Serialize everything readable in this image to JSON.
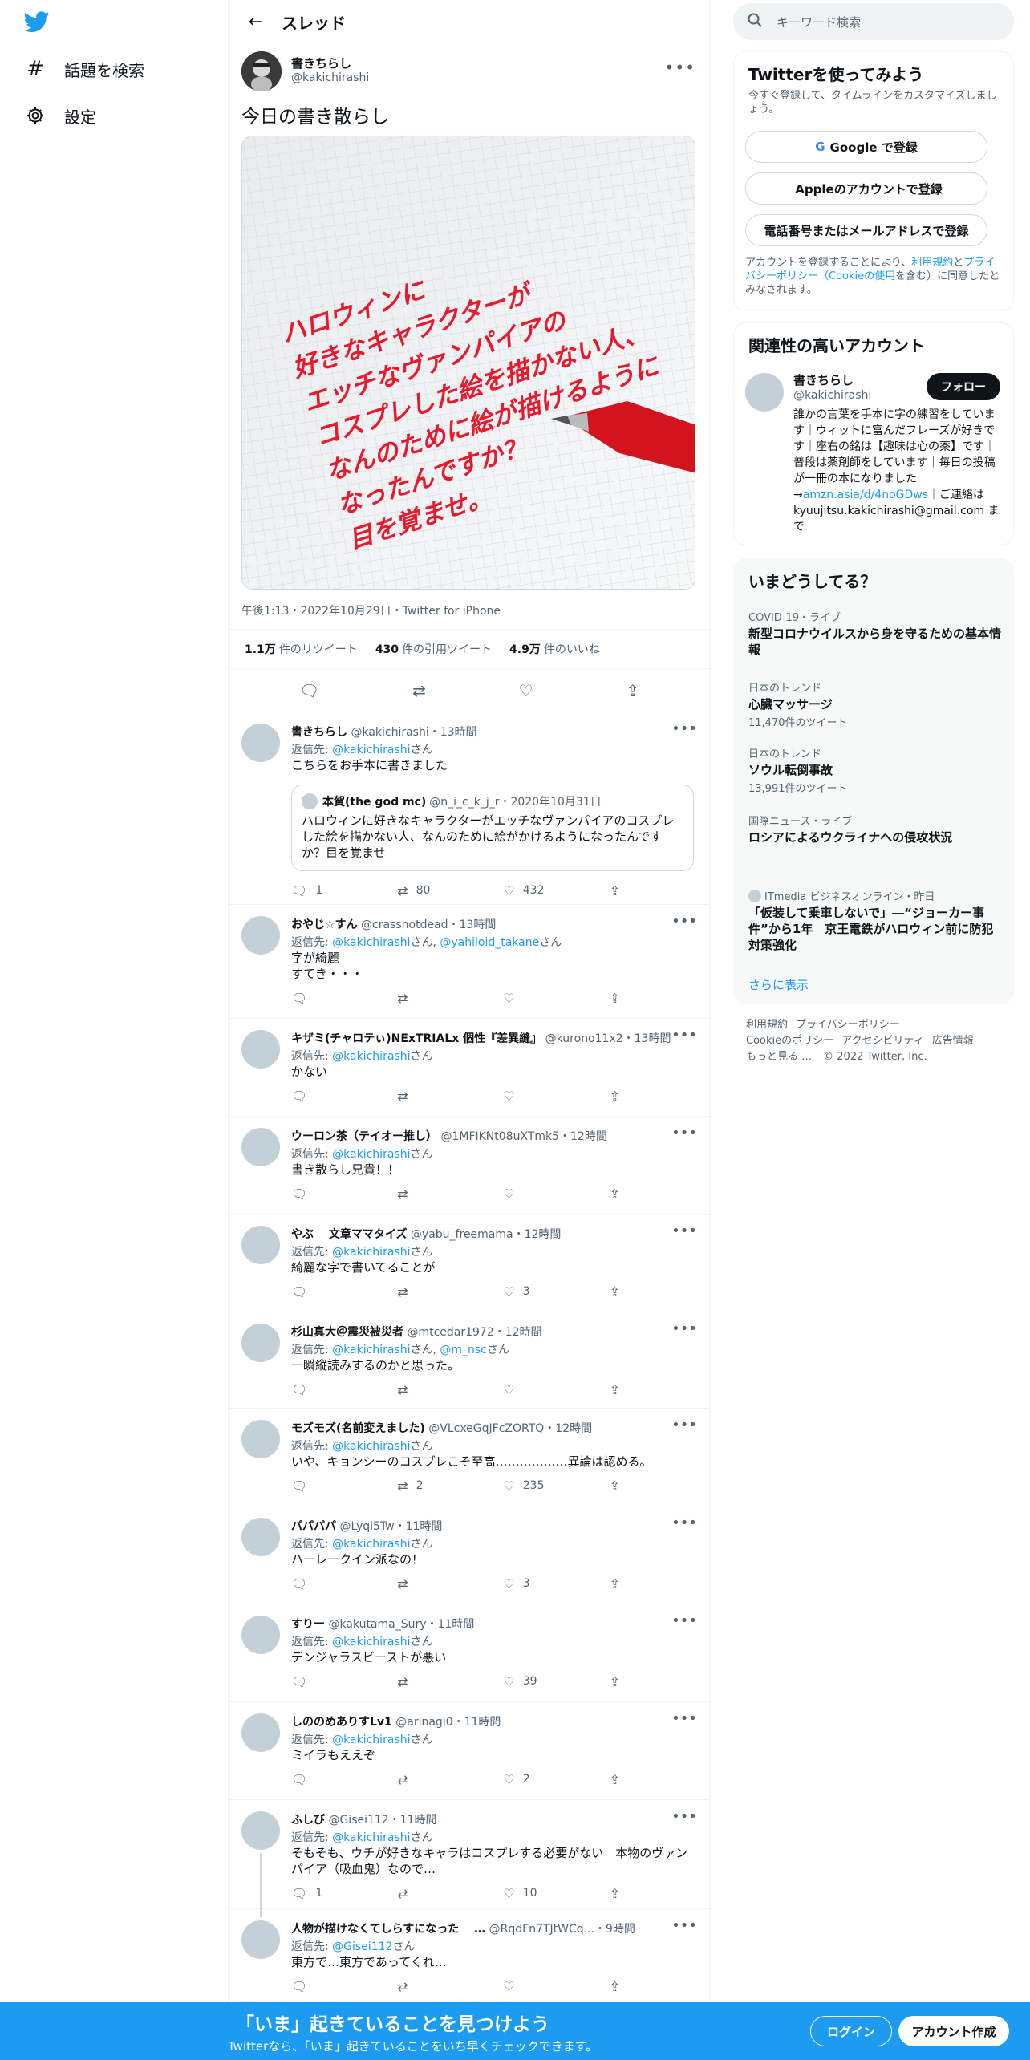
{
  "nav": {
    "explore": "話題を検索",
    "settings": "設定"
  },
  "header": {
    "title": "スレッド"
  },
  "tweet": {
    "name": "書きちらし",
    "handle": "@kakichirashi",
    "text": "今日の書き散らし",
    "image_lines": [
      "ハロウィンに",
      "好きなキャラクターが",
      "エッチなヴァンパイアの",
      "コスプレした絵を描かない人、",
      "なんのために絵が描けるように",
      "なったんですか？",
      "目を覚ませ。"
    ],
    "meta": "午後1:13・2022年10月29日・Twitter for iPhone",
    "retweets": "1.1万",
    "retweets_label": "件のリツイート",
    "quotes": "430",
    "quotes_label": "件の引用ツイート",
    "likes": "4.9万",
    "likes_label": "件のいいね"
  },
  "replies": [
    {
      "name": "書きちらし",
      "handle": "@kakichirashi・13時間",
      "to": [
        "@kakichirashi"
      ],
      "text": "こちらをお手本に書きました",
      "reply": "1",
      "rt": "80",
      "like": "432",
      "quote": {
        "name": "本賀(the god mc)",
        "handle": "@n_i_c_k_j_r・2020年10月31日",
        "text": "ハロウィンに好きなキャラクターがエッチなヴァンパイアのコスプレした絵を描かない人、なんのために絵がかけるようになったんですか？目を覚ませ"
      }
    },
    {
      "name": "おやじ☆すん",
      "handle": "@crassnotdead・13時間",
      "to": [
        "@kakichirashi",
        "@yahiloid_takane"
      ],
      "text": "字が綺麗\nすてき・・・",
      "reply": "",
      "rt": "",
      "like": ""
    },
    {
      "name": "キザミ(チャロテぃ)NExTRIALx 個性『差異縫』",
      "handle": "@kurono11x2・13時間",
      "to": [
        "@kakichirashi"
      ],
      "text": "かない",
      "reply": "",
      "rt": "",
      "like": ""
    },
    {
      "name": "ウーロン茶（テイオー推し）",
      "handle": "@1MFIKNt08uXTmk5・12時間",
      "to": [
        "@kakichirashi"
      ],
      "text": "書き散らし兄貴！！",
      "reply": "",
      "rt": "",
      "like": ""
    },
    {
      "name": "やぶ　 文章ママタイズ",
      "handle": "@yabu_freemama・12時間",
      "to": [
        "@kakichirashi"
      ],
      "text": "綺麗な字で書いてることが",
      "reply": "",
      "rt": "",
      "like": "3"
    },
    {
      "name": "杉山真大＠震災被災者",
      "handle": "@mtcedar1972・12時間",
      "to": [
        "@kakichirashi",
        "@m_nsc"
      ],
      "text": "一瞬縦読みするのかと思った。",
      "reply": "",
      "rt": "",
      "like": ""
    },
    {
      "name": "モズモズ(名前変えました)",
      "handle": "@VLcxeGqJFcZORTQ・12時間",
      "to": [
        "@kakichirashi"
      ],
      "text": "いや、キョンシーのコスプレこそ至高………………異論は認める。",
      "reply": "",
      "rt": "2",
      "like": "235"
    },
    {
      "name": "パパパパ",
      "handle": "@Lyqi5Tw・11時間",
      "to": [
        "@kakichirashi"
      ],
      "text": "ハーレークイン派なの！",
      "reply": "",
      "rt": "",
      "like": "3"
    },
    {
      "name": "すりー",
      "handle": "@kakutama_Sury・11時間",
      "to": [
        "@kakichirashi"
      ],
      "text": "デンジャラスビーストが悪い",
      "reply": "",
      "rt": "",
      "like": "39"
    },
    {
      "name": "しののめありすLv1",
      "handle": "@arinagi0・11時間",
      "to": [
        "@kakichirashi"
      ],
      "text": "ミイラもええぞ",
      "reply": "",
      "rt": "",
      "like": "2"
    },
    {
      "name": "ふしび",
      "handle": "@Gisei112・11時間",
      "to": [
        "@kakichirashi"
      ],
      "text": "そもそも、ウチが好きなキャラはコスプレする必要がない　本物のヴァンパイア（吸血鬼）なので…",
      "reply": "1",
      "rt": "",
      "like": "10"
    },
    {
      "name": "人物が描けなくてしらすになった　 …",
      "handle": "@RqdFn7TJtWCq...・9時間",
      "to": [
        "@Gisei112"
      ],
      "text": "東方で…東方であってくれ…",
      "reply": "",
      "rt": "",
      "like": ""
    }
  ],
  "reply_to_prefix": "返信先: ",
  "reply_to_suffix": "さん",
  "search": {
    "placeholder": "キーワード検索"
  },
  "signup": {
    "title": "Twitterを使ってみよう",
    "desc": "今すぐ登録して、タイムラインをカスタマイズしましょう。",
    "google": "Google で登録",
    "apple": "Appleのアカウントで登録",
    "phone": "電話番号またはメールアドレスで登録",
    "terms_pre": "アカウントを登録することにより、",
    "terms_link1": "利用規約",
    "terms_mid": "と",
    "terms_link2": "プライバシーポリシー",
    "terms_link3": "（Cookieの使用",
    "terms_post": "を含む）に同意したとみなされます。"
  },
  "related": {
    "title": "関連性の高いアカウント",
    "name": "書きちらし",
    "handle": "@kakichirashi",
    "follow": "フォロー",
    "bio": "誰かの言葉を手本に字の練習をしています｜ウィットに富んだフレーズが好きです｜座右の銘は【趣味は心の薬】です｜普段は薬剤師をしています｜毎日の投稿が一冊の本になりました→",
    "bio_link": "amzn.asia/d/4noGDws",
    "bio_post": "｜ご連絡は kyuujitsu.kakichirashi@gmail.com まで"
  },
  "trends": {
    "title": "いまどうしてる？",
    "items": [
      {
        "cat": "COVID-19・ライブ",
        "name": "新型コロナウイルスから身を守るための基本情報",
        "count": ""
      },
      {
        "cat": "日本のトレンド",
        "name": "心臓マッサージ",
        "count": "11,470件のツイート"
      },
      {
        "cat": "日本のトレンド",
        "name": "ソウル転倒事故",
        "count": "13,991件のツイート"
      },
      {
        "cat": "国際ニュース・ライブ",
        "name": "ロシアによるウクライナへの侵攻状況",
        "count": ""
      },
      {
        "cat": "ITmedia ビジネスオンライン・昨日",
        "name": "「仮装して乗車しないで」―“ジョーカー事件”から1年　京王電鉄がハロウィン前に防犯対策強化",
        "count": ""
      }
    ],
    "more": "さらに表示"
  },
  "footer": {
    "links": [
      "利用規約",
      "プライバシーポリシー",
      "Cookieのポリシー",
      "アクセシビリティ",
      "広告情報",
      "もっと見る …"
    ],
    "copyright": "© 2022 Twitter, Inc."
  },
  "bottom": {
    "title": "「いま」起きていることを見つけよう",
    "sub": "Twitterなら、「いま」起きていることをいち早くチェックできます。",
    "login": "ログイン",
    "signup": "アカウント作成"
  },
  "colors": {
    "accent": "#1d9bf0",
    "text": "#0f1419",
    "muted": "#536471",
    "handwriting": "#e8192c"
  }
}
